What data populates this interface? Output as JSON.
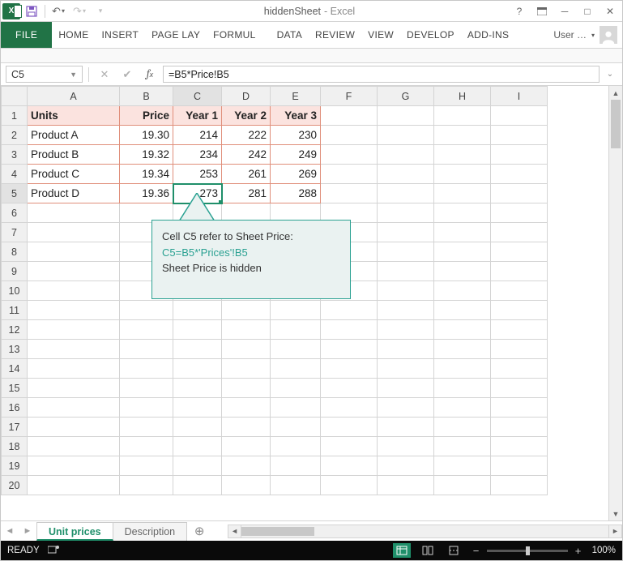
{
  "window": {
    "doc_title": "hiddenSheet",
    "app_name": "- Excel"
  },
  "qat": {
    "save_tip": "Save",
    "undo_tip": "Undo",
    "redo_tip": "Redo"
  },
  "ribbon": {
    "file": "FILE",
    "tabs": [
      "HOME",
      "INSERT",
      "PAGE LAY",
      "FORMUL",
      "DATA",
      "REVIEW",
      "VIEW",
      "DEVELOP",
      "ADD-INS"
    ],
    "user": "User …"
  },
  "formula_bar": {
    "namebox": "C5",
    "formula": "=B5*Price!B5"
  },
  "grid": {
    "col_headers": [
      "A",
      "B",
      "C",
      "D",
      "E",
      "F",
      "G",
      "H",
      "I"
    ],
    "row_count": 20,
    "header_row": {
      "A": "Units",
      "B": "Price",
      "C": "Year 1",
      "D": "Year 2",
      "E": "Year 3"
    },
    "rows": [
      {
        "A": "Product A",
        "B": "19.30",
        "C": "214",
        "D": "222",
        "E": "230"
      },
      {
        "A": "Product B",
        "B": "19.32",
        "C": "234",
        "D": "242",
        "E": "249"
      },
      {
        "A": "Product C",
        "B": "19.34",
        "C": "253",
        "D": "261",
        "E": "269"
      },
      {
        "A": "Product D",
        "B": "19.36",
        "C": "273",
        "D": "281",
        "E": "288"
      }
    ],
    "active_cell": "C5"
  },
  "callout": {
    "line1": "Cell C5 refer to Sheet Price:",
    "line2": "C5=B5*'Prices'!B5",
    "line3": "Sheet Price is hidden"
  },
  "sheet_tabs": {
    "tabs": [
      {
        "name": "Unit prices",
        "active": true
      },
      {
        "name": "Description",
        "active": false
      }
    ],
    "add_tip": "New sheet"
  },
  "status": {
    "mode": "READY",
    "zoom": "100%"
  },
  "chart_data": {
    "type": "table",
    "title": "Units",
    "columns": [
      "Product",
      "Price",
      "Year 1",
      "Year 2",
      "Year 3"
    ],
    "rows": [
      [
        "Product A",
        19.3,
        214,
        222,
        230
      ],
      [
        "Product B",
        19.32,
        234,
        242,
        249
      ],
      [
        "Product C",
        19.34,
        253,
        261,
        269
      ],
      [
        "Product D",
        19.36,
        273,
        281,
        288
      ]
    ]
  }
}
